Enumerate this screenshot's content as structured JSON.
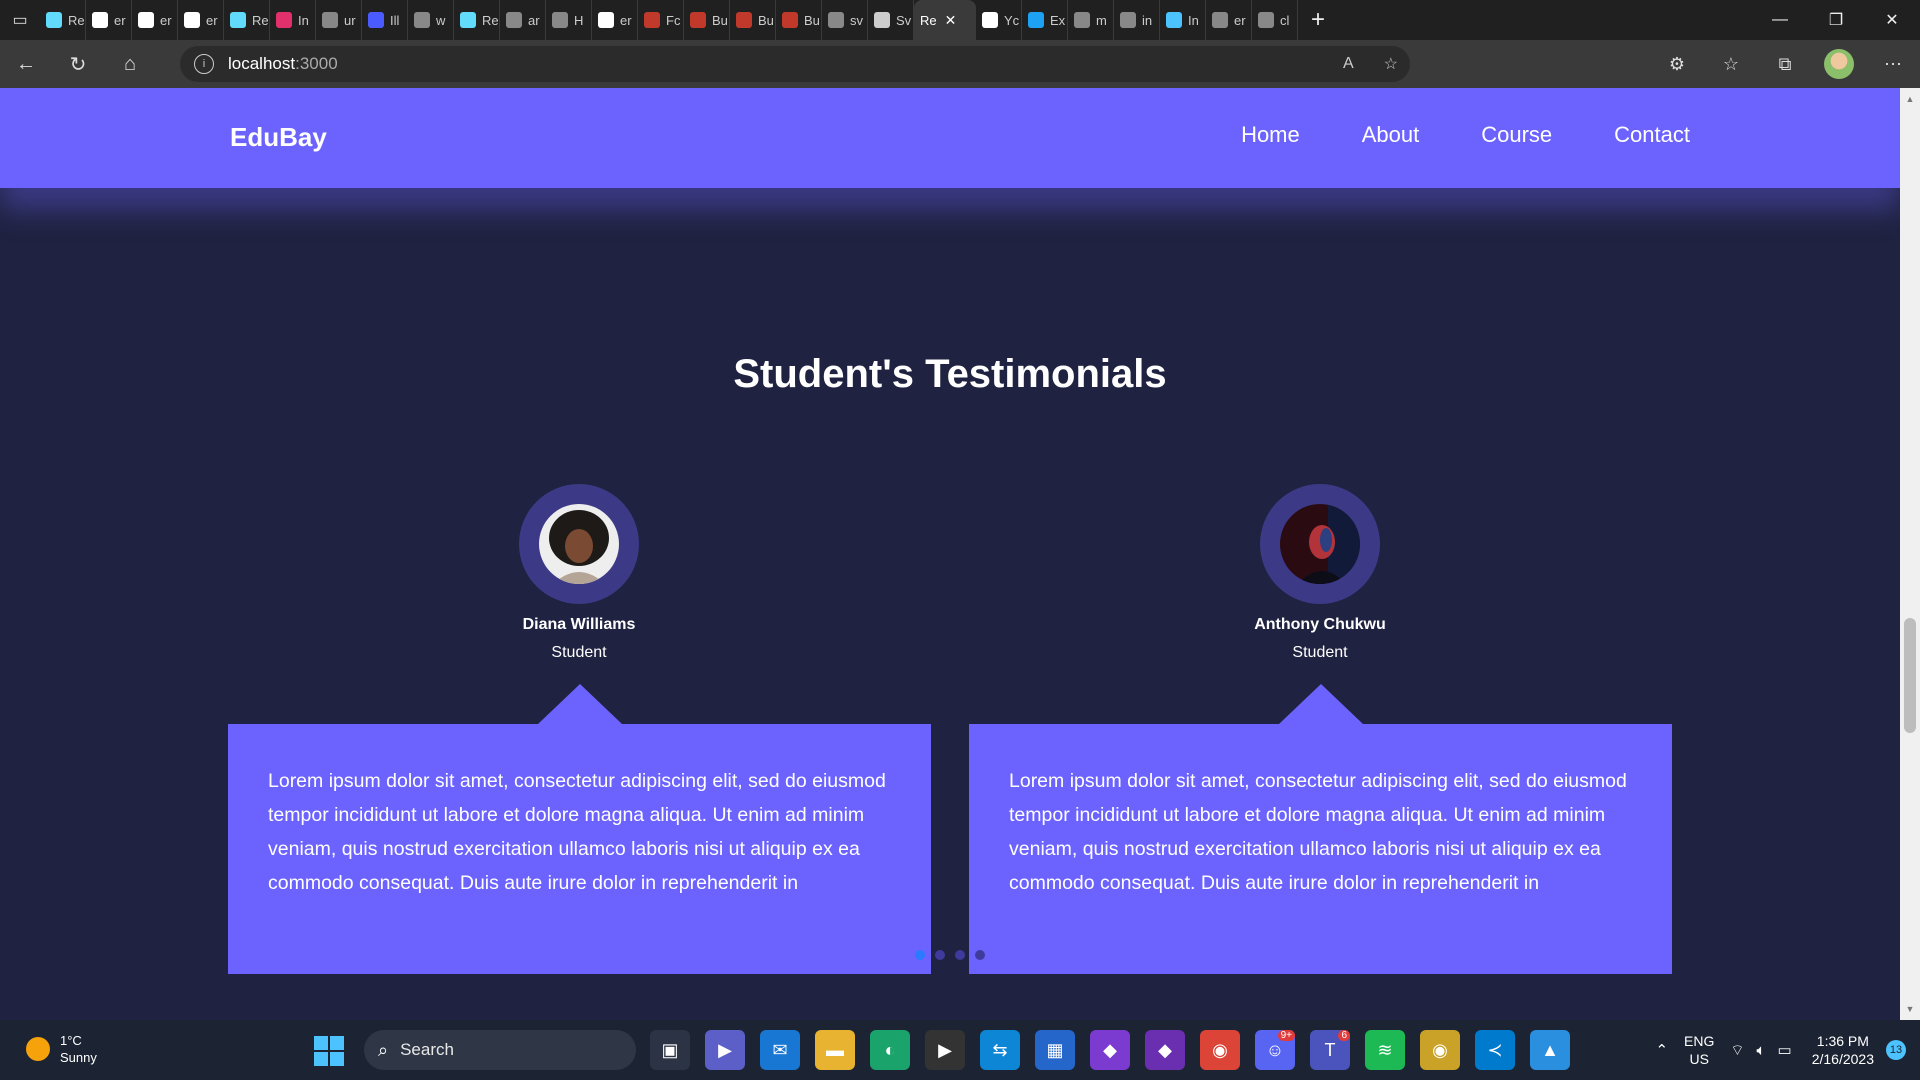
{
  "browser": {
    "tabs": [
      {
        "label": "Re",
        "color": "#61dafb"
      },
      {
        "label": "er",
        "color": "#ffffff"
      },
      {
        "label": "er",
        "color": "#ffffff"
      },
      {
        "label": "er",
        "color": "#ffffff"
      },
      {
        "label": "Re",
        "color": "#61dafb"
      },
      {
        "label": "In",
        "color": "#e1306c"
      },
      {
        "label": "ur",
        "color": "#888888"
      },
      {
        "label": "Ill",
        "color": "#4a5cff"
      },
      {
        "label": "w",
        "color": "#888888"
      },
      {
        "label": "Re",
        "color": "#61dafb"
      },
      {
        "label": "ar",
        "color": "#888888"
      },
      {
        "label": "H",
        "color": "#888888"
      },
      {
        "label": "er",
        "color": "#ffffff"
      },
      {
        "label": "Fc",
        "color": "#c0392b"
      },
      {
        "label": "Bu",
        "color": "#c0392b"
      },
      {
        "label": "Bu",
        "color": "#c0392b"
      },
      {
        "label": "Bu",
        "color": "#c0392b"
      },
      {
        "label": "sv",
        "color": "#888888"
      },
      {
        "label": "Sv",
        "color": "#cccccc"
      }
    ],
    "active_tab": {
      "label": "Re"
    },
    "tabs_after": [
      {
        "label": "Yc",
        "color": "#ffffff"
      },
      {
        "label": "Ex",
        "color": "#1da1f2"
      },
      {
        "label": "m",
        "color": "#888888"
      },
      {
        "label": "in",
        "color": "#888888"
      },
      {
        "label": "In",
        "color": "#4cc2ff"
      },
      {
        "label": "er",
        "color": "#888888"
      },
      {
        "label": "cl",
        "color": "#888888"
      }
    ],
    "url_host": "localhost",
    "url_port": ":3000"
  },
  "site": {
    "brand": "EduBay",
    "nav": [
      "Home",
      "About",
      "Course",
      "Contact"
    ],
    "section_title": "Student's Testimonials",
    "testimonials": [
      {
        "name": "Diana Williams",
        "role": "Student",
        "text": "Lorem ipsum dolor sit amet, consectetur adipiscing elit, sed do eiusmod tempor incididunt ut labore et dolore magna aliqua. Ut enim ad minim veniam, quis nostrud exercitation ullamco laboris nisi ut aliquip ex ea commodo consequat. Duis aute irure dolor in reprehenderit in"
      },
      {
        "name": "Anthony Chukwu",
        "role": "Student",
        "text": "Lorem ipsum dolor sit amet, consectetur adipiscing elit, sed do eiusmod tempor incididunt ut labore et dolore magna aliqua. Ut enim ad minim veniam, quis nostrud exercitation ullamco laboris nisi ut aliquip ex ea commodo consequat. Duis aute irure dolor in reprehenderit in"
      }
    ],
    "carousel": {
      "slides": 4,
      "active": 1
    }
  },
  "taskbar": {
    "weather_temp": "1°C",
    "weather_desc": "Sunny",
    "search_label": "Search",
    "lang_top": "ENG",
    "lang_bottom": "US",
    "time": "1:36 PM",
    "date": "2/16/2023",
    "notification_count": "13",
    "badges": {
      "discord": "9+",
      "teams": "6"
    }
  }
}
